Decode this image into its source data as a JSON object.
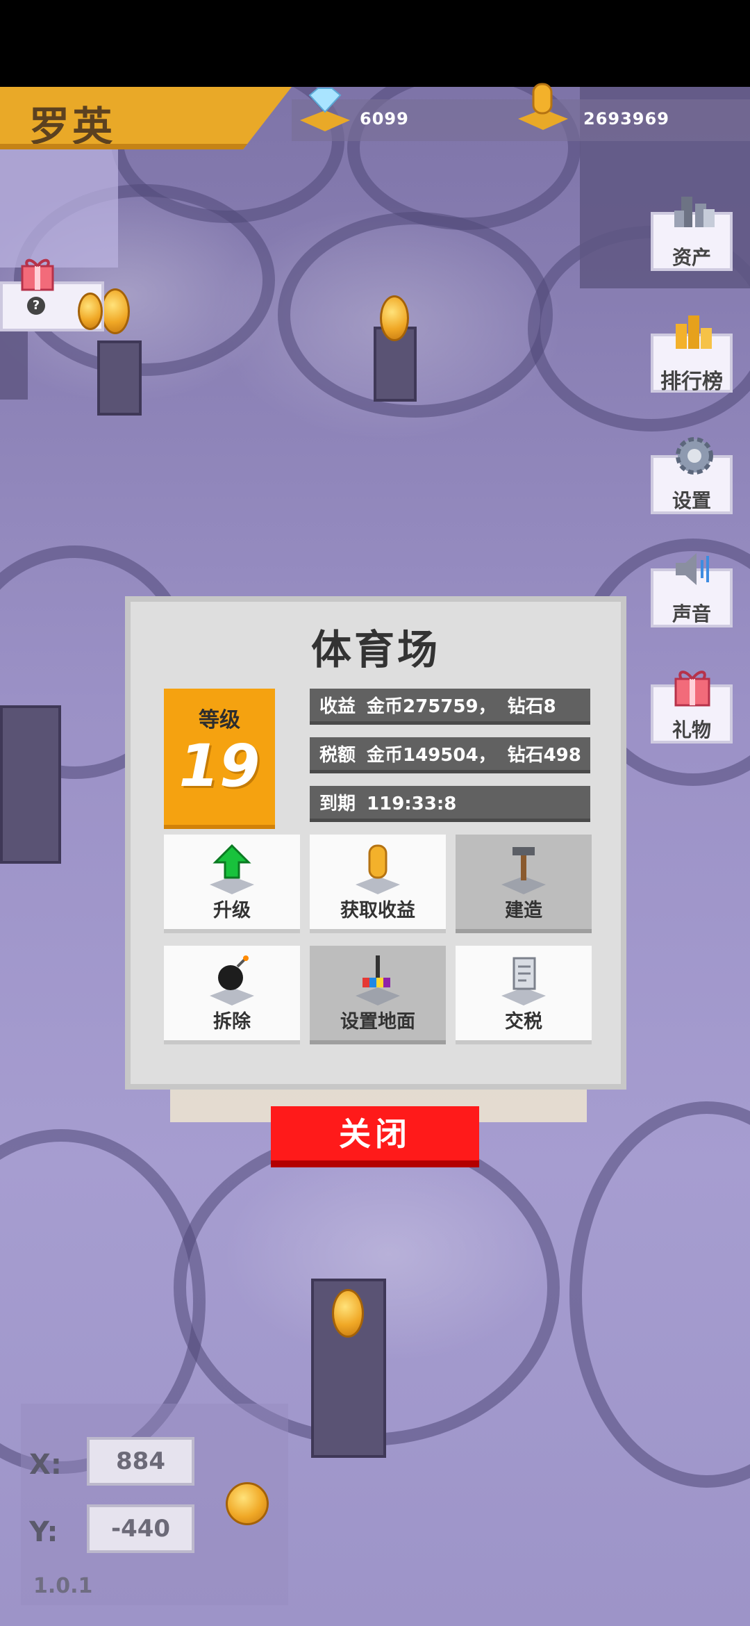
{
  "player": {
    "name": "罗英"
  },
  "resources": {
    "diamonds": "6099",
    "gold": "2693969"
  },
  "side_menu": [
    {
      "label": "资产",
      "icon": "assets-icon"
    },
    {
      "label": "排行榜",
      "icon": "leaderboard-icon"
    },
    {
      "label": "设置",
      "icon": "gear-icon"
    },
    {
      "label": "声音",
      "icon": "speaker-icon"
    },
    {
      "label": "礼物",
      "icon": "gift-icon"
    }
  ],
  "gift_hint": "?",
  "building": {
    "title": "体育场",
    "level_label": "等级",
    "level": "19",
    "income": {
      "label": "收益",
      "gold_text": "金币275759，",
      "diamond_text": "钻石8"
    },
    "tax": {
      "label": "税额",
      "gold_text": "金币149504，",
      "diamond_text": "钻石498"
    },
    "expire": {
      "label": "到期",
      "value": "119:33:8"
    },
    "actions": [
      {
        "label": "升级",
        "icon": "upgrade-arrow-icon",
        "enabled": true
      },
      {
        "label": "获取收益",
        "icon": "coin-icon",
        "enabled": true
      },
      {
        "label": "建造",
        "icon": "hammer-icon",
        "enabled": false
      },
      {
        "label": "拆除",
        "icon": "bomb-icon",
        "enabled": true
      },
      {
        "label": "设置地面",
        "icon": "paint-roller-icon",
        "enabled": false
      },
      {
        "label": "交税",
        "icon": "tax-document-icon",
        "enabled": true
      }
    ],
    "close_label": "关闭"
  },
  "coordinates": {
    "x_label": "X:",
    "x": "884",
    "y_label": "Y:",
    "y": "-440"
  },
  "version": "1.0.1",
  "colors": {
    "accent": "#e9a928",
    "level_bg": "#f5a210",
    "close_red": "#ff1a1a",
    "terrain": "#9b91c6"
  }
}
